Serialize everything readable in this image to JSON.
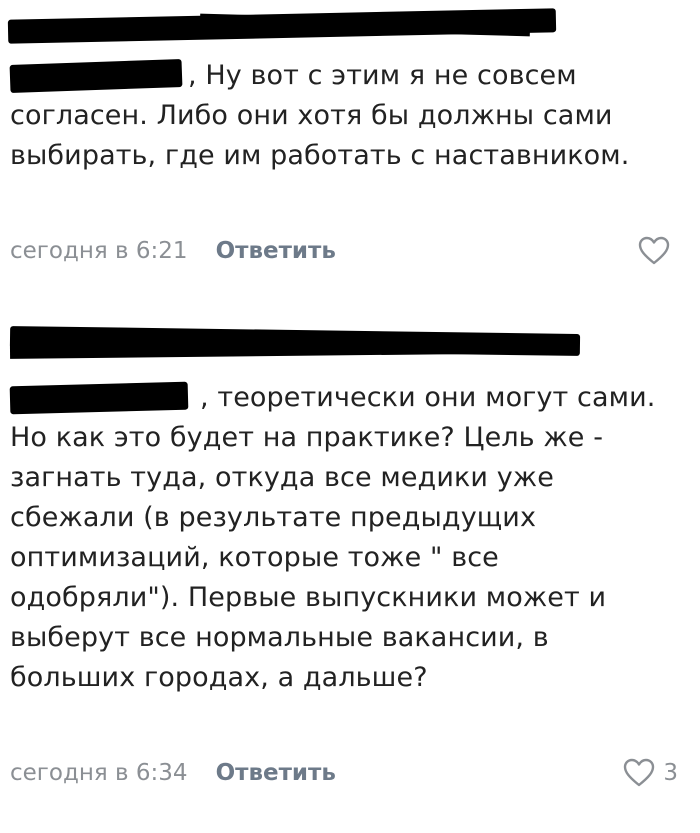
{
  "comments": [
    {
      "author_name": "",
      "reply_to": "",
      "text": ", Ну вот с этим я не совсем согласен. Либо они хотя бы должны сами выбирать, где им работать с наставником.",
      "time": "сегодня в 6:21",
      "reply_label": "Ответить",
      "likes": ""
    },
    {
      "author_name": "",
      "reply_to": "",
      "text": ", теоретически они могут сами. Но как это будет на практике? Цель же - загнать туда, откуда все медики уже сбежали (в результате предыдущих оптимизаций, которые тоже \" все одобряли\"). Первые выпускники может и выберут все нормальные вакансии, в больших городах, а дальше?",
      "time": "сегодня в 6:34",
      "reply_label": "Ответить",
      "likes": "3"
    }
  ],
  "icons": {
    "like": "heart-outline-icon"
  },
  "colors": {
    "text": "#222222",
    "meta": "#8b8f94",
    "reply": "#6d7a89",
    "redaction": "#000000"
  }
}
